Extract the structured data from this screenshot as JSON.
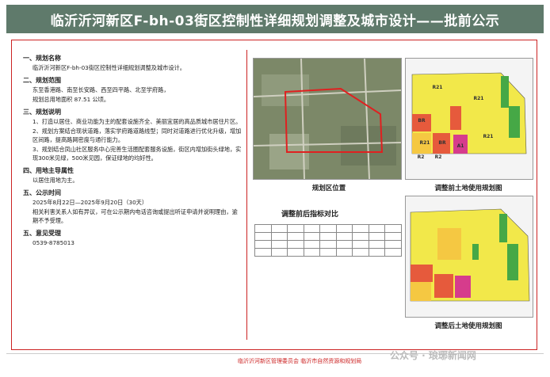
{
  "banner": {
    "title": "临沂沂河新区F-bh-03街区控制性详细规划调整及城市设计——批前公示"
  },
  "sections": [
    {
      "head": "一、规划名称",
      "paras": [
        "临沂沂河新区F-bh-03街区控制性详细规划调整及城市设计。"
      ]
    },
    {
      "head": "二、规划范围",
      "paras": [
        "东至香港路、南至长安路、西至四平路、北至学府路，",
        "规划总用地面积 87.51 公顷。"
      ]
    },
    {
      "head": "三、规划说明",
      "paras": [
        "1、打造以居住、商业功能为主的配套设施齐全、美丽宜居的高品质城市居住片区。",
        "2、规划方案结合现状道路，落实学府路道路线型；同时对道路进行优化升级，增加区间路，提高路网密度与通行能力。",
        "3、规划结合凤山社区服务中心完善生活圈配套服务设施，街区内增加街头绿地，实现300米见绿，500米见园，保证绿地的均好性。"
      ]
    },
    {
      "head": "四、用地主导属性",
      "paras": [
        "以居住用地为主。"
      ]
    },
    {
      "head": "五、公示时间",
      "paras": [
        "2025年8月22日—2025年9月20日（30天）",
        "相关利害关系人如有异议，可在公示期内电话咨询或提出听证申请并说明理由，逾期不予受理。"
      ]
    },
    {
      "head": "五、意见受理",
      "paras": [
        "0539-8785013"
      ]
    }
  ],
  "panels": {
    "location_label": "规划区位置",
    "before_label": "调整前土地使用规划图",
    "after_label": "调整后土地使用规划图",
    "table_title": "调整前后指标对比"
  },
  "table": {
    "headers": [
      "",
      "",
      "",
      "",
      "",
      "",
      "",
      "",
      ""
    ],
    "rows": [
      [
        "",
        "",
        "",
        "",
        "",
        "",
        "",
        "",
        ""
      ],
      [
        "",
        "",
        "",
        "",
        "",
        "",
        "",
        "",
        ""
      ],
      [
        "",
        "",
        "",
        "",
        "",
        "",
        "",
        "",
        ""
      ]
    ]
  },
  "parcels_before": [
    "R21",
    "BR",
    "R21",
    "R21",
    "BR",
    "R21",
    "A1",
    "R2",
    "R2"
  ],
  "footer": {
    "text": "临沂沂河新区管理委员会    临沂市自然资源和规划局"
  },
  "watermark": {
    "text": "公众号 · 琅琊新闻网"
  }
}
